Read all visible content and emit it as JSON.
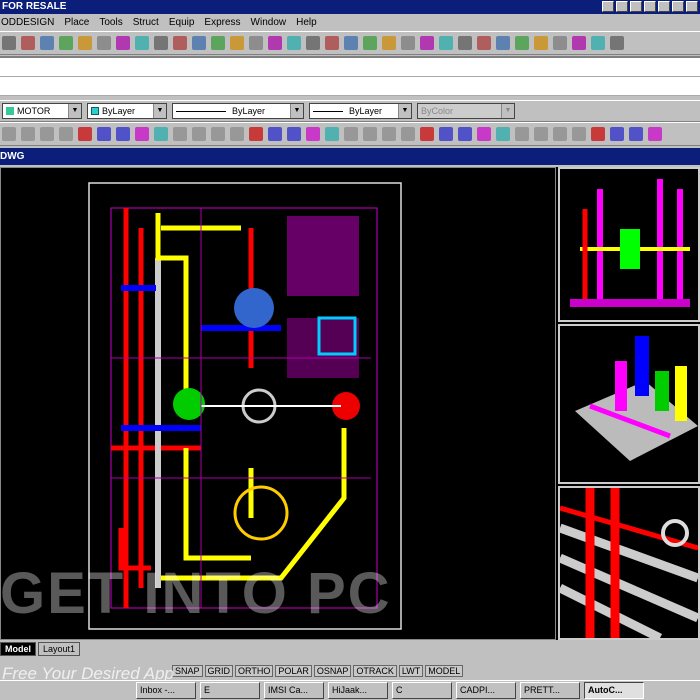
{
  "title": "FOR RESALE",
  "menu": [
    "ODDESIGN",
    "Place",
    "Tools",
    "Struct",
    "Equip",
    "Express",
    "Window",
    "Help"
  ],
  "layer_combo": "MOTOR",
  "color_combo": "ByLayer",
  "linetype_combo": "ByLayer",
  "lineweight_combo": "ByLayer",
  "plotstyle_combo": "ByColor",
  "drawing_title": "DWG",
  "tabs": [
    "Model",
    "Layout1"
  ],
  "status": [
    "SNAP",
    "GRID",
    "ORTHO",
    "POLAR",
    "OSNAP",
    "OTRACK",
    "LWT",
    "MODEL"
  ],
  "taskbar": [
    "Inbox -...",
    "E",
    "IMSI Ca...",
    "HiJaak...",
    "C",
    "CADPI...",
    "PRETT...",
    "AutoC..."
  ],
  "watermark": "GET INTO PC",
  "watermark_sub": "Free Your Desired App"
}
